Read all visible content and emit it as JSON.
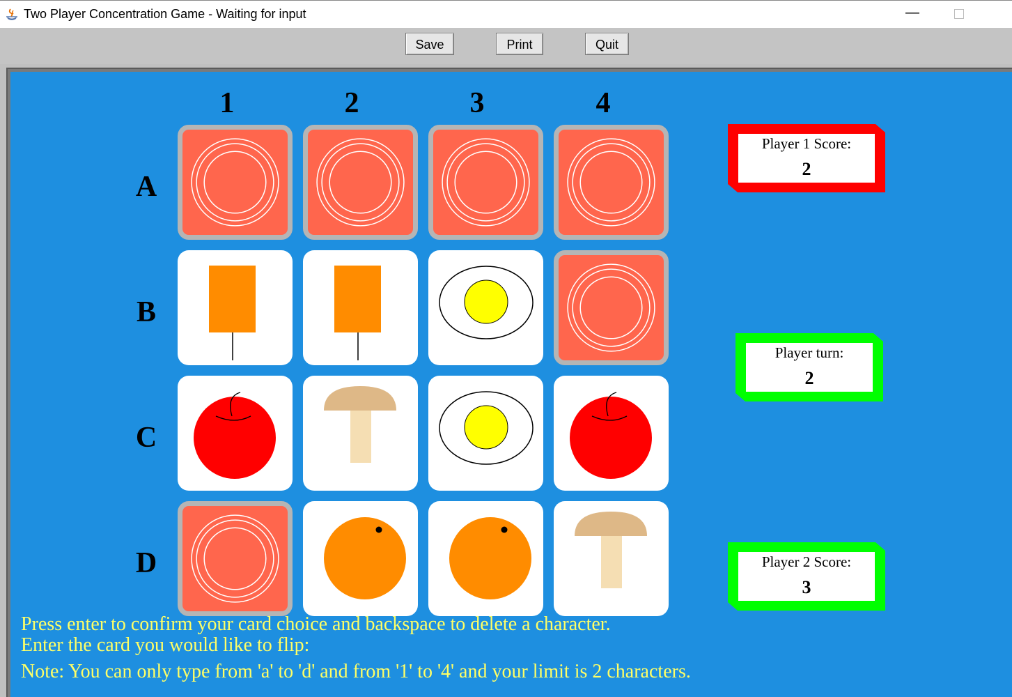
{
  "window": {
    "title": "Two Player Concentration Game - Waiting for input",
    "minimize_glyph": "—"
  },
  "toolbar": {
    "save_label": "Save",
    "print_label": "Print",
    "quit_label": "Quit"
  },
  "board": {
    "background": "#1e8fe0",
    "columns": [
      "1",
      "2",
      "3",
      "4"
    ],
    "rows": [
      "A",
      "B",
      "C",
      "D"
    ],
    "cards": [
      [
        "face-down",
        "face-down",
        "face-down",
        "face-down"
      ],
      [
        "popsicle",
        "popsicle",
        "egg",
        "face-down"
      ],
      [
        "apple",
        "mushroom",
        "egg",
        "apple"
      ],
      [
        "face-down",
        "orange",
        "orange",
        "mushroom"
      ]
    ]
  },
  "scores": {
    "player1": {
      "label": "Player 1 Score:",
      "value": "2",
      "color": "#ff0000"
    },
    "turn": {
      "label": "Player turn:",
      "value": "2",
      "color": "#00ff00"
    },
    "player2": {
      "label": "Player 2 Score:",
      "value": "3",
      "color": "#00ff00"
    }
  },
  "messages": {
    "line1": "Press enter to confirm your card choice and backspace to delete a character.",
    "line2": "Enter the card you would like to flip:",
    "line3": "Note: You can only type from 'a' to 'd' and from '1' to '4' and your limit is 2 characters."
  },
  "colors": {
    "card_back": "#ff664d",
    "card_back_border": "#b5b5b5",
    "message_text": "#ffff66"
  }
}
